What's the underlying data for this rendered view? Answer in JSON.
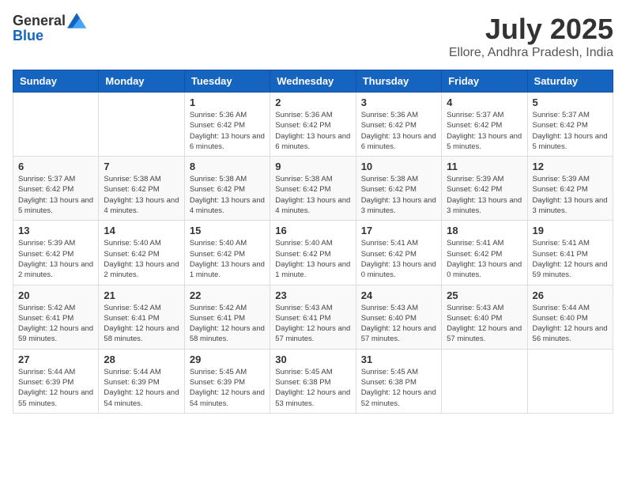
{
  "logo": {
    "general": "General",
    "blue": "Blue"
  },
  "header": {
    "month": "July 2025",
    "location": "Ellore, Andhra Pradesh, India"
  },
  "weekdays": [
    "Sunday",
    "Monday",
    "Tuesday",
    "Wednesday",
    "Thursday",
    "Friday",
    "Saturday"
  ],
  "weeks": [
    [
      {
        "day": "",
        "info": ""
      },
      {
        "day": "",
        "info": ""
      },
      {
        "day": "1",
        "info": "Sunrise: 5:36 AM\nSunset: 6:42 PM\nDaylight: 13 hours and 6 minutes."
      },
      {
        "day": "2",
        "info": "Sunrise: 5:36 AM\nSunset: 6:42 PM\nDaylight: 13 hours and 6 minutes."
      },
      {
        "day": "3",
        "info": "Sunrise: 5:36 AM\nSunset: 6:42 PM\nDaylight: 13 hours and 6 minutes."
      },
      {
        "day": "4",
        "info": "Sunrise: 5:37 AM\nSunset: 6:42 PM\nDaylight: 13 hours and 5 minutes."
      },
      {
        "day": "5",
        "info": "Sunrise: 5:37 AM\nSunset: 6:42 PM\nDaylight: 13 hours and 5 minutes."
      }
    ],
    [
      {
        "day": "6",
        "info": "Sunrise: 5:37 AM\nSunset: 6:42 PM\nDaylight: 13 hours and 5 minutes."
      },
      {
        "day": "7",
        "info": "Sunrise: 5:38 AM\nSunset: 6:42 PM\nDaylight: 13 hours and 4 minutes."
      },
      {
        "day": "8",
        "info": "Sunrise: 5:38 AM\nSunset: 6:42 PM\nDaylight: 13 hours and 4 minutes."
      },
      {
        "day": "9",
        "info": "Sunrise: 5:38 AM\nSunset: 6:42 PM\nDaylight: 13 hours and 4 minutes."
      },
      {
        "day": "10",
        "info": "Sunrise: 5:38 AM\nSunset: 6:42 PM\nDaylight: 13 hours and 3 minutes."
      },
      {
        "day": "11",
        "info": "Sunrise: 5:39 AM\nSunset: 6:42 PM\nDaylight: 13 hours and 3 minutes."
      },
      {
        "day": "12",
        "info": "Sunrise: 5:39 AM\nSunset: 6:42 PM\nDaylight: 13 hours and 3 minutes."
      }
    ],
    [
      {
        "day": "13",
        "info": "Sunrise: 5:39 AM\nSunset: 6:42 PM\nDaylight: 13 hours and 2 minutes."
      },
      {
        "day": "14",
        "info": "Sunrise: 5:40 AM\nSunset: 6:42 PM\nDaylight: 13 hours and 2 minutes."
      },
      {
        "day": "15",
        "info": "Sunrise: 5:40 AM\nSunset: 6:42 PM\nDaylight: 13 hours and 1 minute."
      },
      {
        "day": "16",
        "info": "Sunrise: 5:40 AM\nSunset: 6:42 PM\nDaylight: 13 hours and 1 minute."
      },
      {
        "day": "17",
        "info": "Sunrise: 5:41 AM\nSunset: 6:42 PM\nDaylight: 13 hours and 0 minutes."
      },
      {
        "day": "18",
        "info": "Sunrise: 5:41 AM\nSunset: 6:42 PM\nDaylight: 13 hours and 0 minutes."
      },
      {
        "day": "19",
        "info": "Sunrise: 5:41 AM\nSunset: 6:41 PM\nDaylight: 12 hours and 59 minutes."
      }
    ],
    [
      {
        "day": "20",
        "info": "Sunrise: 5:42 AM\nSunset: 6:41 PM\nDaylight: 12 hours and 59 minutes."
      },
      {
        "day": "21",
        "info": "Sunrise: 5:42 AM\nSunset: 6:41 PM\nDaylight: 12 hours and 58 minutes."
      },
      {
        "day": "22",
        "info": "Sunrise: 5:42 AM\nSunset: 6:41 PM\nDaylight: 12 hours and 58 minutes."
      },
      {
        "day": "23",
        "info": "Sunrise: 5:43 AM\nSunset: 6:41 PM\nDaylight: 12 hours and 57 minutes."
      },
      {
        "day": "24",
        "info": "Sunrise: 5:43 AM\nSunset: 6:40 PM\nDaylight: 12 hours and 57 minutes."
      },
      {
        "day": "25",
        "info": "Sunrise: 5:43 AM\nSunset: 6:40 PM\nDaylight: 12 hours and 57 minutes."
      },
      {
        "day": "26",
        "info": "Sunrise: 5:44 AM\nSunset: 6:40 PM\nDaylight: 12 hours and 56 minutes."
      }
    ],
    [
      {
        "day": "27",
        "info": "Sunrise: 5:44 AM\nSunset: 6:39 PM\nDaylight: 12 hours and 55 minutes."
      },
      {
        "day": "28",
        "info": "Sunrise: 5:44 AM\nSunset: 6:39 PM\nDaylight: 12 hours and 54 minutes."
      },
      {
        "day": "29",
        "info": "Sunrise: 5:45 AM\nSunset: 6:39 PM\nDaylight: 12 hours and 54 minutes."
      },
      {
        "day": "30",
        "info": "Sunrise: 5:45 AM\nSunset: 6:38 PM\nDaylight: 12 hours and 53 minutes."
      },
      {
        "day": "31",
        "info": "Sunrise: 5:45 AM\nSunset: 6:38 PM\nDaylight: 12 hours and 52 minutes."
      },
      {
        "day": "",
        "info": ""
      },
      {
        "day": "",
        "info": ""
      }
    ]
  ]
}
